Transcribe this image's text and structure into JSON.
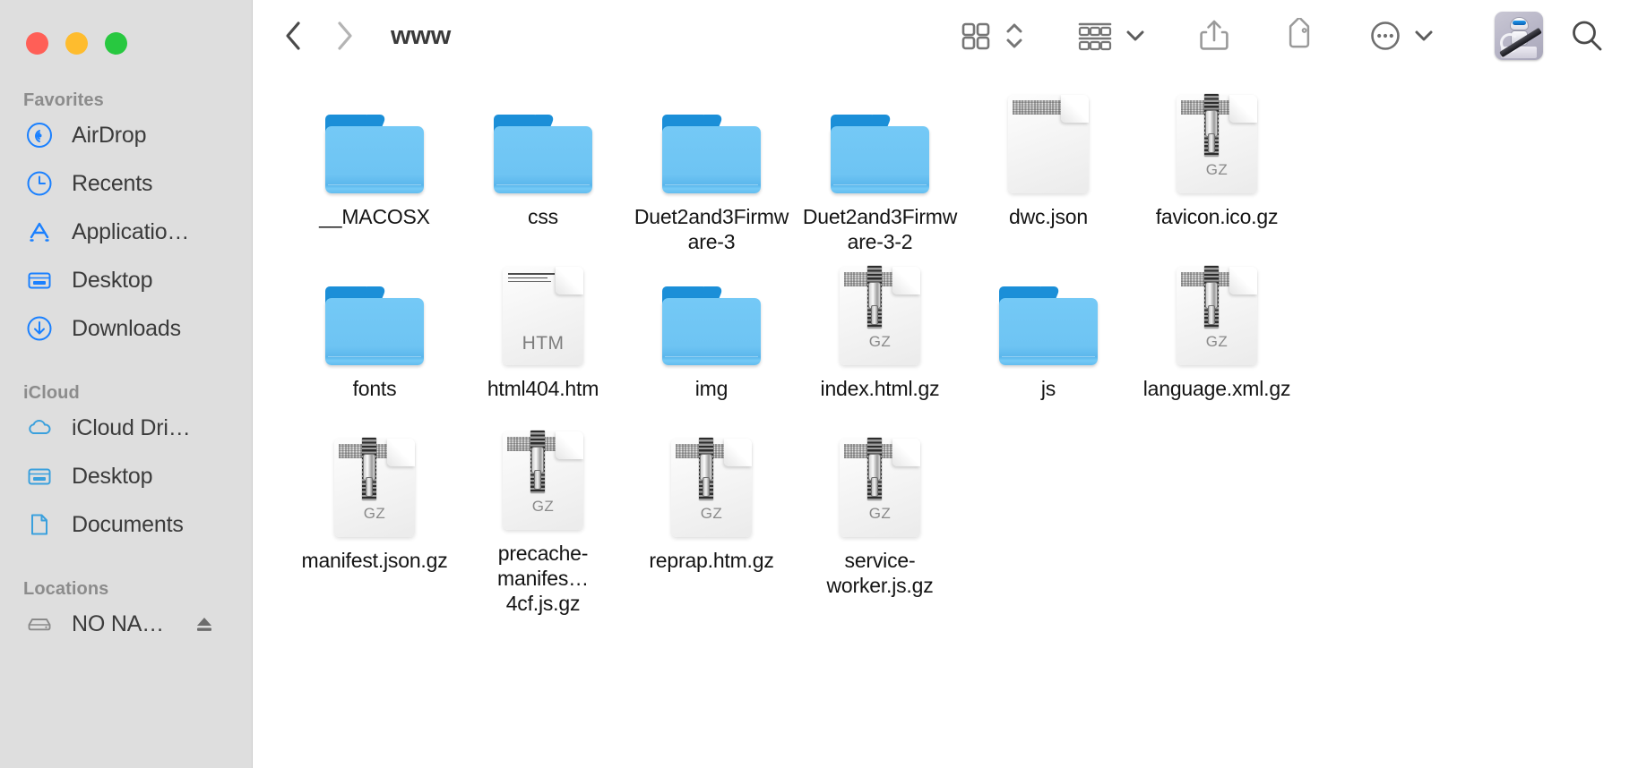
{
  "window": {
    "title": "www",
    "traffic_lights": [
      {
        "name": "close",
        "color": "#ff5f57"
      },
      {
        "name": "minimize",
        "color": "#febc2e"
      },
      {
        "name": "maximize",
        "color": "#28c840"
      }
    ]
  },
  "toolbar": {
    "back_icon": "chevron-left-icon",
    "forward_icon": "chevron-right-icon",
    "view_icon": "icon-view-grid-icon",
    "view_sort_icon": "chevron-up-down-icon",
    "group_icon": "group-by-icon",
    "group_chevron_icon": "chevron-down-icon",
    "share_icon": "share-icon",
    "tags_icon": "tag-icon",
    "more_icon": "ellipsis-circle-icon",
    "more_chevron_icon": "chevron-down-icon",
    "app_icon": "automator-app-icon",
    "search_icon": "search-icon"
  },
  "sidebar": {
    "sections": [
      {
        "title": "Favorites",
        "items": [
          {
            "label": "AirDrop",
            "icon": "airdrop-icon",
            "color": "#1a80ff"
          },
          {
            "label": "Recents",
            "icon": "clock-icon",
            "color": "#1a80ff"
          },
          {
            "label": "Applicatio…",
            "icon": "applications-icon",
            "color": "#1a80ff"
          },
          {
            "label": "Desktop",
            "icon": "desktop-icon",
            "color": "#1a80ff"
          },
          {
            "label": "Downloads",
            "icon": "download-icon",
            "color": "#1a80ff"
          }
        ]
      },
      {
        "title": "iCloud",
        "items": [
          {
            "label": "iCloud Dri…",
            "icon": "cloud-icon",
            "color": "#3aa0dd"
          },
          {
            "label": "Desktop",
            "icon": "desktop-icon",
            "color": "#3aa0dd"
          },
          {
            "label": "Documents",
            "icon": "document-icon",
            "color": "#3aa0dd"
          }
        ]
      },
      {
        "title": "Locations",
        "items": [
          {
            "label": "NO NA…",
            "icon": "harddisk-icon",
            "color": "#8a8a8a",
            "eject": true,
            "eject_icon": "eject-icon"
          }
        ]
      }
    ]
  },
  "files": [
    {
      "name": "__MACOSX",
      "type": "folder"
    },
    {
      "name": "css",
      "type": "folder"
    },
    {
      "name": "Duet2and3Firmware-3",
      "type": "folder"
    },
    {
      "name": "Duet2and3Firmware-3-2",
      "type": "folder"
    },
    {
      "name": "dwc.json",
      "type": "document",
      "ext": ""
    },
    {
      "name": "favicon.ico.gz",
      "type": "archive",
      "ext": "GZ"
    },
    {
      "name": "fonts",
      "type": "folder"
    },
    {
      "name": "html404.htm",
      "type": "html",
      "ext": "HTM"
    },
    {
      "name": "img",
      "type": "folder"
    },
    {
      "name": "index.html.gz",
      "type": "archive",
      "ext": "GZ"
    },
    {
      "name": "js",
      "type": "folder"
    },
    {
      "name": "language.xml.gz",
      "type": "archive",
      "ext": "GZ"
    },
    {
      "name": "manifest.json.gz",
      "type": "archive",
      "ext": "GZ"
    },
    {
      "name": "precache-manifes…4cf.js.gz",
      "type": "archive",
      "ext": "GZ"
    },
    {
      "name": "reprap.htm.gz",
      "type": "archive",
      "ext": "GZ"
    },
    {
      "name": "service-worker.js.gz",
      "type": "archive",
      "ext": "GZ"
    }
  ],
  "colors": {
    "sidebar_bg": "#dedede",
    "main_bg": "#ffffff",
    "accent_blue": "#1a80ff",
    "folder_blue": "#6ec4f3",
    "text_primary": "#141414",
    "text_secondary": "#8c8c8c"
  }
}
